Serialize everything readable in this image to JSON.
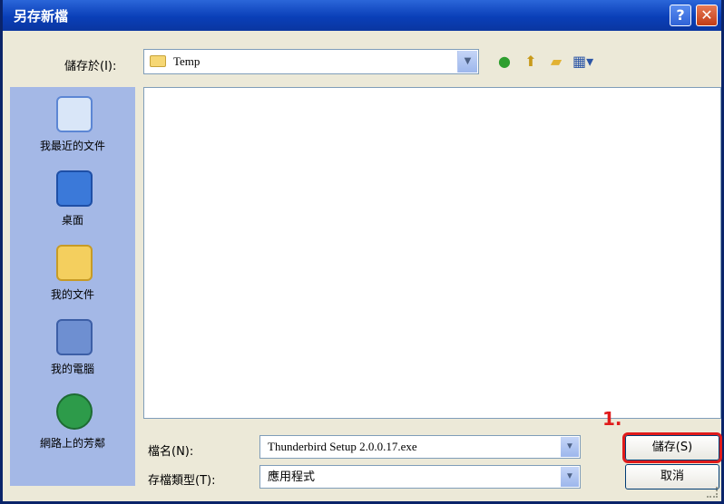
{
  "window": {
    "title": "另存新檔"
  },
  "save_in": {
    "label": "儲存於(I):",
    "value": "Temp"
  },
  "places": [
    {
      "label": "我最近的文件",
      "icon": "recent-documents-icon"
    },
    {
      "label": "桌面",
      "icon": "desktop-icon"
    },
    {
      "label": "我的文件",
      "icon": "my-documents-icon"
    },
    {
      "label": "我的電腦",
      "icon": "my-computer-icon"
    },
    {
      "label": "網路上的芳鄰",
      "icon": "network-places-icon"
    }
  ],
  "filename": {
    "label": "檔名(N):",
    "value": "Thunderbird Setup 2.0.0.17.exe"
  },
  "filetype": {
    "label": "存檔類型(T):",
    "value": "應用程式"
  },
  "buttons": {
    "save": "儲存(S)",
    "cancel": "取消"
  },
  "annotation": "1.",
  "title_buttons": {
    "help": "?",
    "close": "✕"
  },
  "colors": {
    "title_bar": "#0A3FB8",
    "places_bar": "#A4B8E6",
    "highlight": "#E01B1B"
  }
}
